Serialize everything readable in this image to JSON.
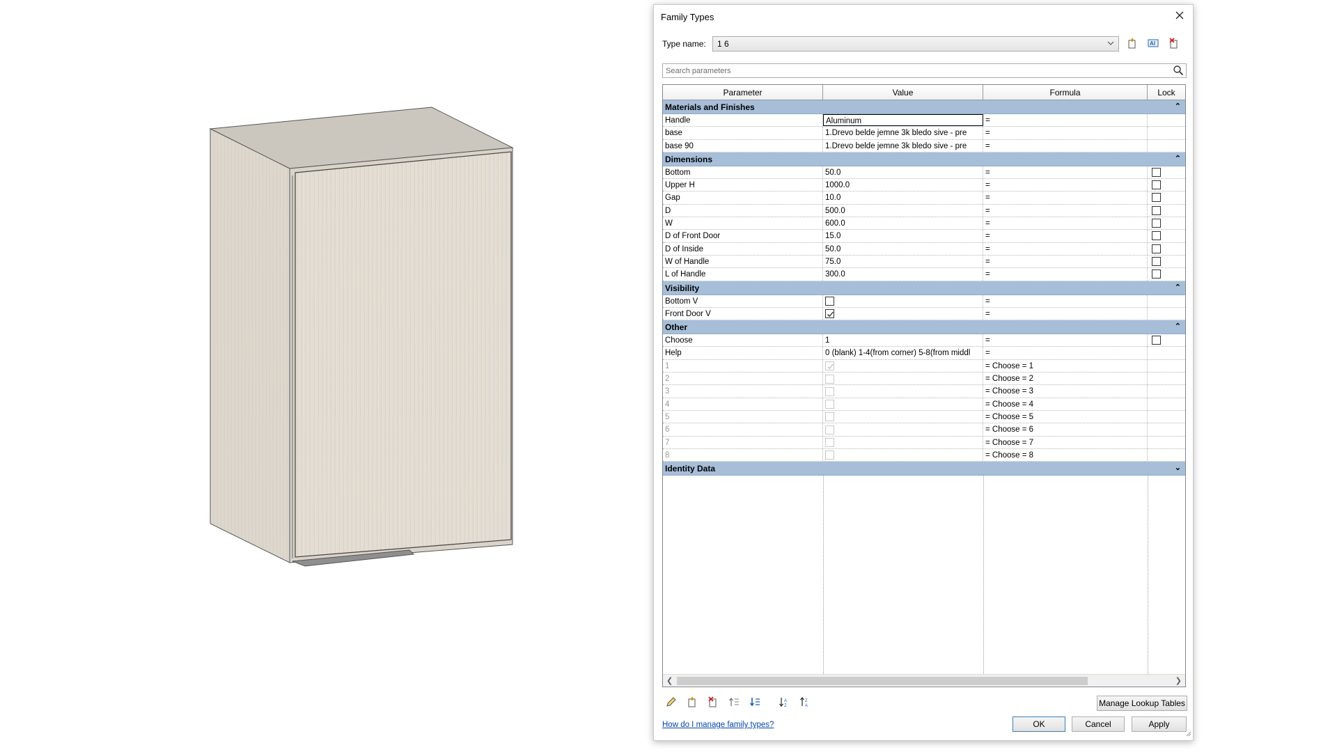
{
  "dialog": {
    "title": "Family Types",
    "type_name_label": "Type name:",
    "type_name_value": "1 6",
    "search_placeholder": "Search parameters"
  },
  "columns": [
    "Parameter",
    "Value",
    "Formula",
    "Lock"
  ],
  "groups": [
    {
      "name": "Materials and Finishes",
      "collapse": "⌃",
      "rows": [
        {
          "param": "Handle",
          "value": "Aluminum",
          "formula": "=",
          "editing": true
        },
        {
          "param": "base",
          "value": "1.Drevo belde jemne 3k bledo sive - pre",
          "formula": "="
        },
        {
          "param": "base 90",
          "value": "1.Drevo belde jemne 3k bledo sive - pre",
          "formula": "="
        }
      ]
    },
    {
      "name": "Dimensions",
      "collapse": "⌃",
      "rows": [
        {
          "param": "Bottom",
          "value": "50.0",
          "formula": "=",
          "lock": false
        },
        {
          "param": "Upper H",
          "value": "1000.0",
          "formula": "=",
          "lock": false
        },
        {
          "param": "Gap",
          "value": "10.0",
          "formula": "=",
          "lock": false
        },
        {
          "param": "D",
          "value": "500.0",
          "formula": "=",
          "lock": false
        },
        {
          "param": "W",
          "value": "600.0",
          "formula": "=",
          "lock": false
        },
        {
          "param": "D of Front Door",
          "value": "15.0",
          "formula": "=",
          "lock": false
        },
        {
          "param": "D of Inside",
          "value": "50.0",
          "formula": "=",
          "lock": false
        },
        {
          "param": "W of Handle",
          "value": "75.0",
          "formula": "=",
          "lock": false
        },
        {
          "param": "L of Handle",
          "value": "300.0",
          "formula": "=",
          "lock": false
        }
      ]
    },
    {
      "name": "Visibility",
      "collapse": "⌃",
      "rows": [
        {
          "param": "Bottom V",
          "check": false,
          "formula": "="
        },
        {
          "param": "Front Door V",
          "check": true,
          "formula": "="
        }
      ]
    },
    {
      "name": "Other",
      "collapse": "⌃",
      "rows": [
        {
          "param": "Choose",
          "value": "1",
          "formula": "=",
          "lock": false
        },
        {
          "param": "Help",
          "value": "0 (blank) 1-4(from corner) 5-8(from middl",
          "formula": "="
        },
        {
          "param": "1",
          "check": true,
          "faint": true,
          "dim": true,
          "formula": "= Choose = 1"
        },
        {
          "param": "2",
          "check": false,
          "faint": true,
          "dim": true,
          "formula": "= Choose = 2"
        },
        {
          "param": "3",
          "check": false,
          "faint": true,
          "dim": true,
          "formula": "= Choose = 3"
        },
        {
          "param": "4",
          "check": false,
          "faint": true,
          "dim": true,
          "formula": "= Choose = 4"
        },
        {
          "param": "5",
          "check": false,
          "faint": true,
          "dim": true,
          "formula": "= Choose = 5"
        },
        {
          "param": "6",
          "check": false,
          "faint": true,
          "dim": true,
          "formula": "= Choose = 6"
        },
        {
          "param": "7",
          "check": false,
          "faint": true,
          "dim": true,
          "formula": "= Choose = 7"
        },
        {
          "param": "8",
          "check": false,
          "faint": true,
          "dim": true,
          "formula": "= Choose = 8"
        }
      ]
    },
    {
      "name": "Identity Data",
      "collapse": "⌄",
      "rows": []
    }
  ],
  "buttons": {
    "manage_lookup": "Manage Lookup Tables",
    "ok": "OK",
    "cancel": "Cancel",
    "apply": "Apply"
  },
  "help_link": "How do I manage family types?",
  "icons": {
    "close": "close-icon",
    "new_type": "new-type-icon",
    "rename_type": "rename-type-icon",
    "delete_type": "delete-type-icon",
    "search": "search-icon",
    "edit_param": "pencil-icon",
    "new_param": "new-parameter-icon",
    "delete_param": "delete-parameter-icon",
    "move_up": "move-up-icon",
    "move_down": "move-down-icon",
    "sort_asc": "sort-ascending-icon",
    "sort_desc": "sort-descending-icon"
  },
  "colors": {
    "group_header": "#a7bed9",
    "cabinet_front": "#e2dcd2",
    "cabinet_side": "#d8d2c8",
    "cabinet_top": "#cac6bd",
    "link": "#0645ad"
  }
}
